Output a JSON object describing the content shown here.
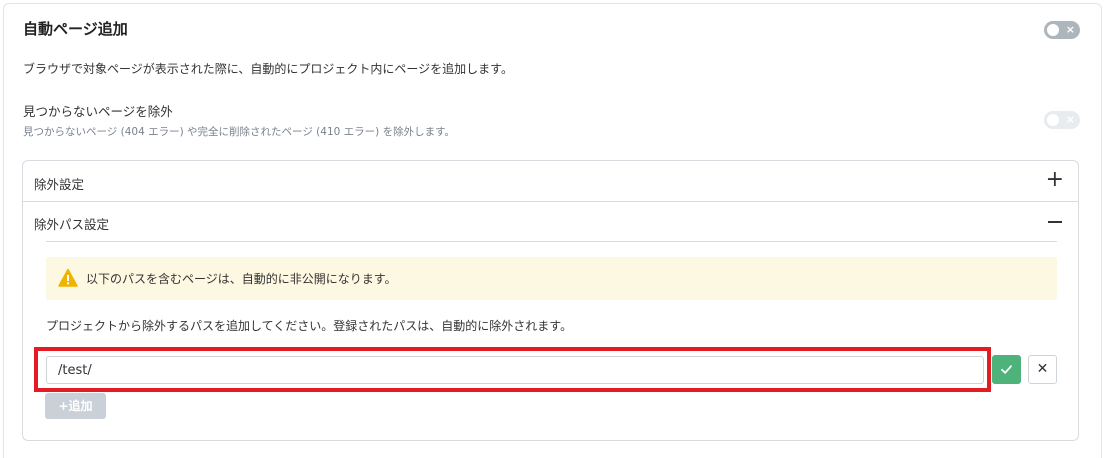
{
  "header": {
    "title": "自動ページ追加",
    "description": "ブラウザで対象ページが表示された際に、自動的にプロジェクト内にページを追加します。",
    "toggle_icon": "×"
  },
  "exclude_not_found": {
    "title": "見つからないページを除外",
    "description": "見つからないページ (404 エラー) や完全に削除されたページ (410 エラー) を除外します。",
    "toggle_icon": "×"
  },
  "accordion": {
    "section1": {
      "label": "除外設定",
      "toggle_icon": "+"
    },
    "section2": {
      "label": "除外パス設定"
    },
    "alert_text": "以下のパスを含むページは、自動的に非公開になります。",
    "help_text": "プロジェクトから除外するパスを追加してください。登録されたパスは、自動的に除外されます。",
    "path_value": "/test/",
    "cancel_icon": "✕",
    "add_label": "+追加"
  },
  "colors": {
    "highlight": "#e31b23",
    "confirm": "#4db37a",
    "warning_bg": "#fdf8e1",
    "warning_icon": "#f0b400"
  }
}
